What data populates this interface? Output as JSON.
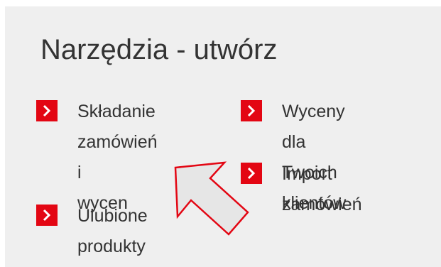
{
  "title": "Narzędzia - utwórz",
  "accent_color": "#e30613",
  "arrow_fill_color": "#e6e6e6",
  "arrow_outline_color": "#e30613",
  "items": [
    {
      "id": "skladanie",
      "label": "Składanie\nzamówień i\nwycen",
      "icon": "chevron-right-icon"
    },
    {
      "id": "ulubione",
      "label": "Ulubione\nprodukty",
      "icon": "chevron-right-icon"
    },
    {
      "id": "wyceny",
      "label": "Wyceny dla\nTwoich klientów",
      "icon": "chevron-right-icon"
    },
    {
      "id": "import",
      "label": "Import zamówień",
      "icon": "chevron-right-icon"
    }
  ]
}
